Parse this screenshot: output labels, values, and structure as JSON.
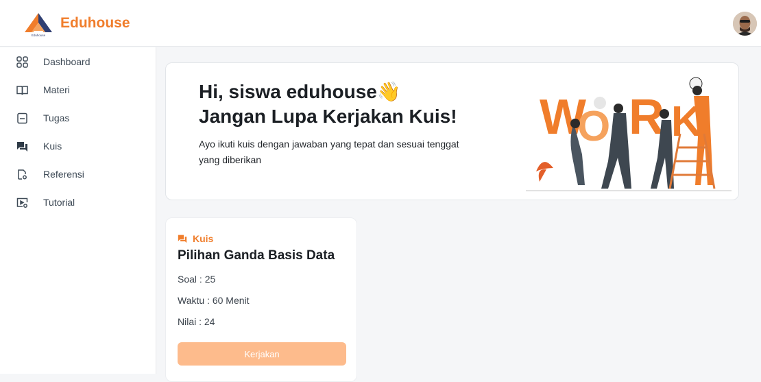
{
  "brand": {
    "name": "Eduhouse",
    "logo_caption": "Eduhouse"
  },
  "sidebar": {
    "items": [
      {
        "label": "Dashboard",
        "icon": "grid-icon"
      },
      {
        "label": "Materi",
        "icon": "book-open-icon"
      },
      {
        "label": "Tugas",
        "icon": "clipboard-icon"
      },
      {
        "label": "Kuis",
        "icon": "chat-bubbles-icon"
      },
      {
        "label": "Referensi",
        "icon": "document-gear-icon"
      },
      {
        "label": "Tutorial",
        "icon": "video-gear-icon"
      }
    ]
  },
  "hero": {
    "greeting": "Hi, siswa eduhouse",
    "greeting_emoji": "👋",
    "headline": "Jangan Lupa Kerjakan Kuis!",
    "description": "Ayo ikuti kuis dengan jawaban yang tepat dan sesuai tenggat yang diberikan",
    "illustration_letters": [
      "W",
      "O",
      "R",
      "K"
    ]
  },
  "quiz_card": {
    "type_label": "Kuis",
    "title": "Pilihan Ganda Basis Data",
    "questions": "Soal : 25",
    "duration": "Waktu : 60 Menit",
    "score": "Nilai : 24",
    "button_label": "Kerjakan"
  },
  "colors": {
    "accent": "#f07d2b",
    "button": "#fdbb8c",
    "text": "#1b1f24"
  }
}
